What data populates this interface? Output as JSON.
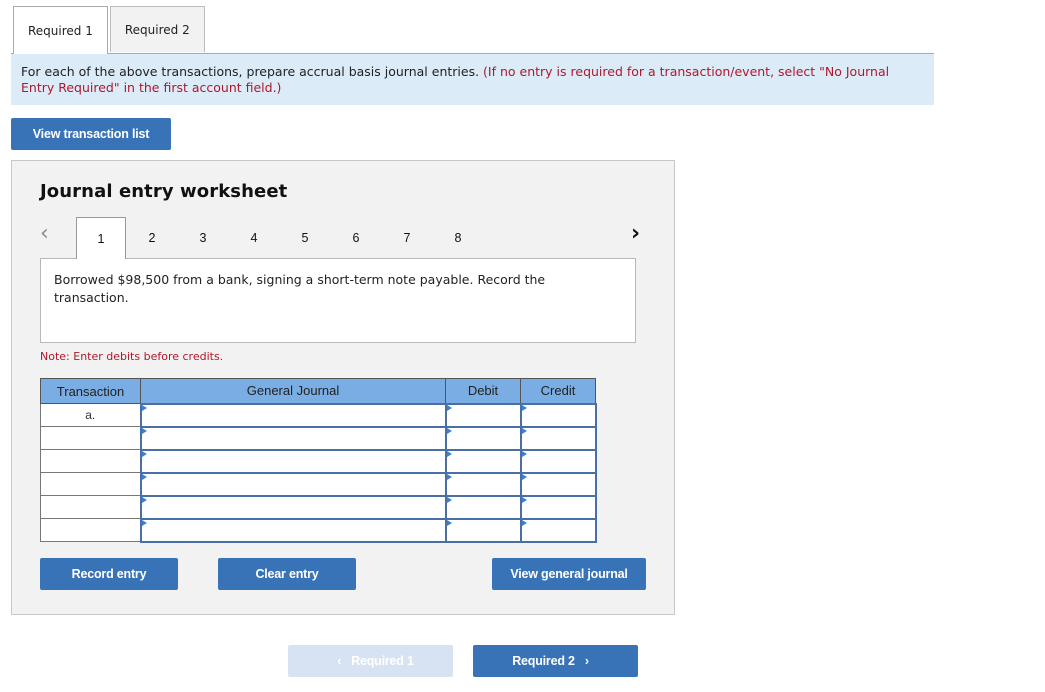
{
  "tabs": [
    {
      "label": "Required 1",
      "active": true
    },
    {
      "label": "Required 2",
      "active": false
    }
  ],
  "instructions": {
    "main": "For each of the above transactions, prepare accrual basis journal entries.",
    "note": "(If no entry is required for a transaction/event, select \"No Journal Entry Required\" in the first account field.)"
  },
  "buttons": {
    "view_transaction_list": "View transaction list",
    "record_entry": "Record entry",
    "clear_entry": "Clear entry",
    "view_general_journal": "View general journal",
    "prev_required": "Required 1",
    "next_required": "Required 2"
  },
  "worksheet": {
    "title": "Journal entry worksheet",
    "prev_icon": "‹",
    "next_icon": "›",
    "pages": [
      "1",
      "2",
      "3",
      "4",
      "5",
      "6",
      "7",
      "8"
    ],
    "active_page": "1",
    "description": "Borrowed $98,500 from a bank, signing a short-term note payable. Record the transaction.",
    "note": "Note: Enter debits before credits.",
    "table": {
      "headers": [
        "Transaction",
        "General Journal",
        "Debit",
        "Credit"
      ],
      "rows": [
        {
          "transaction": "a.",
          "account": "",
          "debit": "",
          "credit": ""
        },
        {
          "transaction": "",
          "account": "",
          "debit": "",
          "credit": ""
        },
        {
          "transaction": "",
          "account": "",
          "debit": "",
          "credit": ""
        },
        {
          "transaction": "",
          "account": "",
          "debit": "",
          "credit": ""
        },
        {
          "transaction": "",
          "account": "",
          "debit": "",
          "credit": ""
        },
        {
          "transaction": "",
          "account": "",
          "debit": "",
          "credit": ""
        }
      ]
    }
  },
  "colors": {
    "primary": "#3873b8",
    "header_blue": "#7aade3",
    "instruction_bg": "#dbebf8",
    "alert_red": "#b0182b",
    "disabled_btn": "#d7e3f2"
  }
}
